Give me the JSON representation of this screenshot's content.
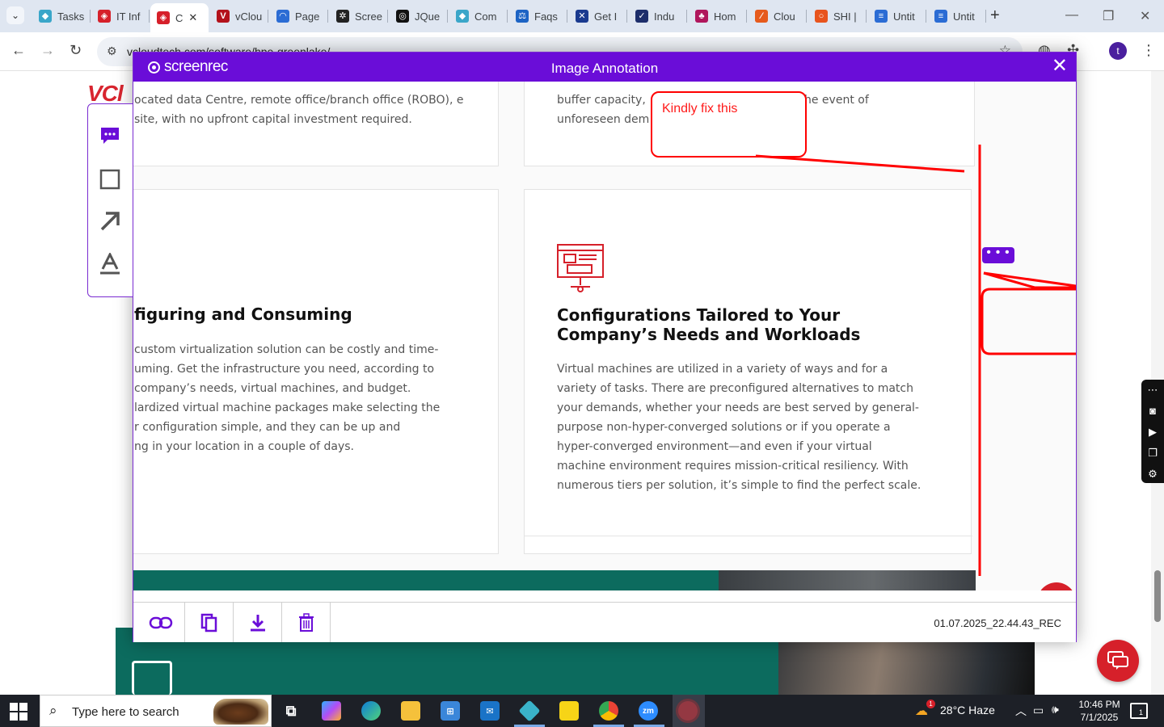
{
  "browser": {
    "tabs": [
      {
        "label": "Tasks",
        "color": "#3aa6c9",
        "glyph": "◆"
      },
      {
        "label": "IT Inf",
        "color": "#d6202a",
        "glyph": "◈"
      },
      {
        "label": "C",
        "color": "#d6202a",
        "glyph": "◈",
        "active": true
      },
      {
        "label": "vClou",
        "color": "#b3121b",
        "glyph": "V"
      },
      {
        "label": "Page",
        "color": "#2b6cd4",
        "glyph": "◠"
      },
      {
        "label": "Scree",
        "color": "#222222",
        "glyph": "✲"
      },
      {
        "label": "JQue",
        "color": "#111111",
        "glyph": "◎"
      },
      {
        "label": "Com",
        "color": "#3aa6c9",
        "glyph": "◆"
      },
      {
        "label": "Faqs",
        "color": "#1c63c4",
        "glyph": "⚖"
      },
      {
        "label": "Get I",
        "color": "#1a3a8f",
        "glyph": "✕"
      },
      {
        "label": "Indu",
        "color": "#1d2e6b",
        "glyph": "✓"
      },
      {
        "label": "Hom",
        "color": "#b0165c",
        "glyph": "♣"
      },
      {
        "label": "Clou",
        "color": "#e65a1c",
        "glyph": "⁄"
      },
      {
        "label": "SHI |",
        "color": "#e8541d",
        "glyph": "○"
      },
      {
        "label": "Untit",
        "color": "#2b6cd4",
        "glyph": "≡"
      },
      {
        "label": "Untit",
        "color": "#2b6cd4",
        "glyph": "≡"
      }
    ],
    "url": "vcloudtech.com/software/hpe-greenlake/",
    "profile_initial": "t"
  },
  "modal": {
    "brand": "screenrec",
    "title": "Image Annotation",
    "close_glyph": "✕",
    "annotation_text": "Kindly fix this",
    "more_glyph": "• • •",
    "filename": "01.07.2025_22.44.43_REC",
    "footer_buttons": [
      "link-button",
      "copy-button",
      "download-button",
      "delete-button"
    ],
    "tools": [
      "comment-tool",
      "rectangle-tool",
      "arrow-tool",
      "text-tool"
    ],
    "accent_color": "#6a0dd8",
    "annotation_color": "#ff0000"
  },
  "page": {
    "card_top_left_text": "ocated data Centre, remote office/branch office (ROBO), e site, with no upfront capital investment required.",
    "card_top_right_text_a": "buffer capacity,",
    "card_top_right_text_b": "he event of",
    "card_top_right_text_c": "unforeseen dem",
    "card_left_title": "figuring and Consuming",
    "card_left_lines": [
      "custom virtualization solution can be costly and time-",
      "uming. Get the infrastructure you need, according to",
      "company’s needs, virtual machines, and budget.",
      "lardized virtual machine packages make selecting the",
      "r configuration simple, and they can be up and",
      "ng in your location in a couple of days."
    ],
    "card_right_title_1": "Configurations Tailored to Your",
    "card_right_title_2": "Company’s Needs and Workloads",
    "card_right_lines": [
      "Virtual machines are utilized in a variety of ways and for a",
      "variety of tasks. There are preconfigured alternatives to match",
      "your demands, whether your needs are best served by general-",
      "purpose non-hyper-converged solutions or if you operate a",
      "hyper-converged environment—and even if your virtual",
      "machine environment requires mission-critical resiliency. With",
      "numerous tiers per solution, it’s simple to find the perfect scale."
    ],
    "logo": "VCl"
  },
  "taskbar": {
    "search_placeholder": "Type here to search",
    "weather": "28°C  Haze",
    "weather_badge": "1",
    "time": "10:46 PM",
    "date": "7/1/2025",
    "notification_count": "1"
  }
}
